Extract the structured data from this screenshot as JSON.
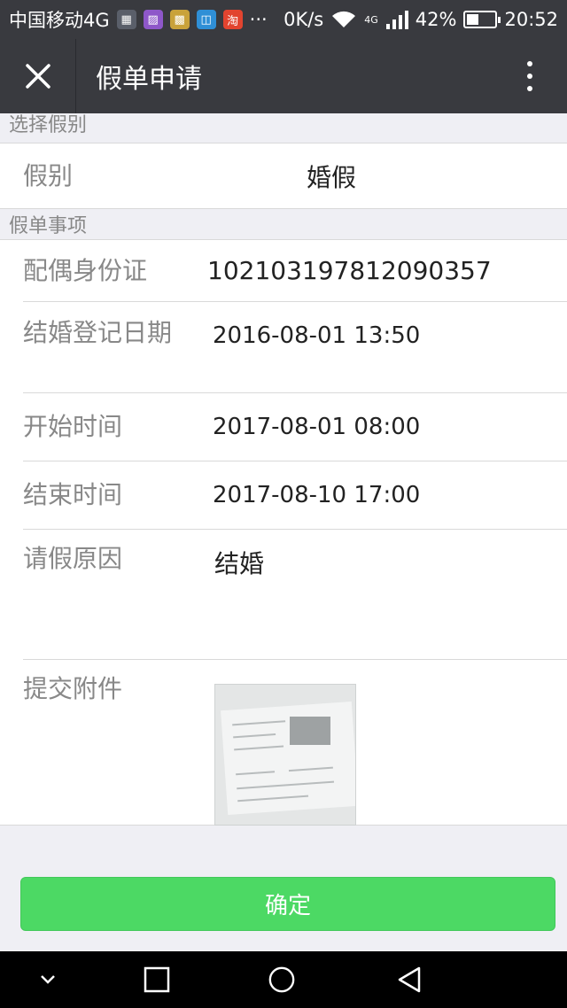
{
  "status_bar": {
    "carrier": "中国移动4G",
    "more": "···",
    "speed": "0K/s",
    "network": "4G",
    "battery": "42%",
    "battery_level": 0.42,
    "time": "20:52",
    "taobao_label": "淘"
  },
  "nav": {
    "title": "假单申请"
  },
  "section_leave_type": {
    "header": "选择假别",
    "label": "假别",
    "value": "婚假"
  },
  "section_details": {
    "header": "假单事项",
    "fields": [
      {
        "label": "配偶身份证",
        "value": "102103197812090357"
      },
      {
        "label": "结婚登记日期",
        "value": "2016-08-01 13:50"
      },
      {
        "label": "开始时间",
        "value": "2017-08-01 08:00"
      },
      {
        "label": "结束时间",
        "value": "2017-08-10 17:00"
      },
      {
        "label": "请假原因",
        "value": "结婚"
      },
      {
        "label": "提交附件"
      }
    ]
  },
  "confirm_label": "确定",
  "colors": {
    "header_bg": "#393a3f",
    "accent_green": "#4cd964",
    "page_bg": "#efeff4"
  }
}
